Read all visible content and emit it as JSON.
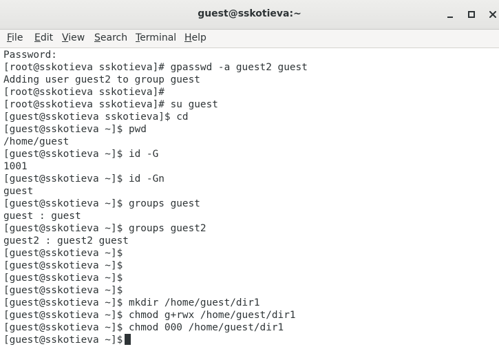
{
  "window": {
    "title": "guest@sskotieva:~"
  },
  "menubar": {
    "items": [
      {
        "pre": "",
        "mnemonic": "F",
        "rest": "ile"
      },
      {
        "pre": "",
        "mnemonic": "E",
        "rest": "dit"
      },
      {
        "pre": "",
        "mnemonic": "V",
        "rest": "iew"
      },
      {
        "pre": "",
        "mnemonic": "S",
        "rest": "earch"
      },
      {
        "pre": "",
        "mnemonic": "T",
        "rest": "erminal"
      },
      {
        "pre": "",
        "mnemonic": "H",
        "rest": "elp"
      }
    ]
  },
  "terminal": {
    "lines": [
      "Password:",
      "[root@sskotieva sskotieva]# gpasswd -a guest2 guest",
      "Adding user guest2 to group guest",
      "[root@sskotieva sskotieva]#",
      "[root@sskotieva sskotieva]# su guest",
      "[guest@sskotieva sskotieva]$ cd",
      "[guest@sskotieva ~]$ pwd",
      "/home/guest",
      "[guest@sskotieva ~]$ id -G",
      "1001",
      "[guest@sskotieva ~]$ id -Gn",
      "guest",
      "[guest@sskotieva ~]$ groups guest",
      "guest : guest",
      "[guest@sskotieva ~]$ groups guest2",
      "guest2 : guest2 guest",
      "[guest@sskotieva ~]$",
      "[guest@sskotieva ~]$",
      "[guest@sskotieva ~]$",
      "[guest@sskotieva ~]$",
      "[guest@sskotieva ~]$ mkdir /home/guest/dir1",
      "[guest@sskotieva ~]$ chmod g+rwx /home/guest/dir1",
      "[guest@sskotieva ~]$ chmod 000 /home/guest/dir1",
      "[guest@sskotieva ~]$"
    ]
  }
}
